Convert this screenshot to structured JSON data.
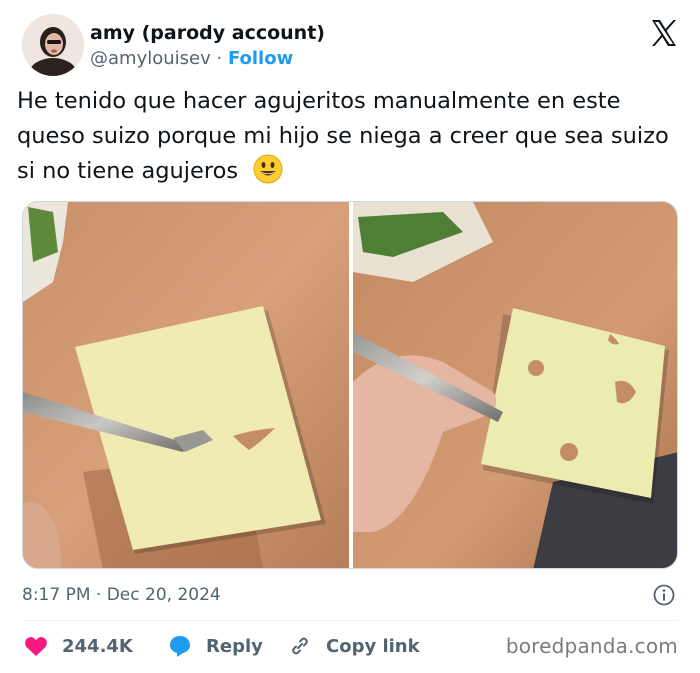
{
  "author": {
    "display_name": "amy (parody account)",
    "handle": "@amylouisev",
    "separator": "·",
    "follow_label": "Follow"
  },
  "tweet": {
    "text": "He tenido que hacer agujeritos manualmente en este queso suizo porque mi hijo se niega a creer que sea suizo si no tiene agujeros"
  },
  "media": {
    "photos": [
      "photo-1",
      "photo-2"
    ]
  },
  "meta": {
    "timestamp": "8:17 PM · Dec 20, 2024"
  },
  "actions": {
    "likes": "244.4K",
    "reply_label": "Reply",
    "copy_label": "Copy link"
  },
  "watermark": "boredpanda.com",
  "icons": [
    "x-logo-icon",
    "smiley-emoji-icon",
    "info-icon",
    "heart-icon",
    "reply-bubble-icon",
    "link-icon"
  ],
  "colors": {
    "accent": "#1d9bf0",
    "like": "#f91880",
    "text": "#0f1419",
    "muted": "#536471"
  }
}
